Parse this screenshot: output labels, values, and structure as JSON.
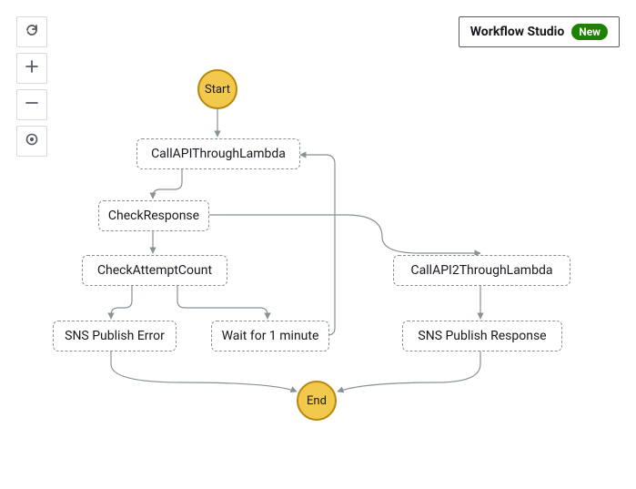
{
  "toolbar": {
    "refresh": "Refresh",
    "zoom_in": "Zoom in",
    "zoom_out": "Zoom out",
    "center": "Center"
  },
  "header": {
    "workflow_studio_label": "Workflow Studio",
    "new_badge": "New"
  },
  "diagram": {
    "start": "Start",
    "end": "End",
    "nodes": {
      "callAPI": "CallAPIThroughLambda",
      "checkResponse": "CheckResponse",
      "checkAttempt": "CheckAttemptCount",
      "snsError": "SNS Publish Error",
      "wait": "Wait for 1 minute",
      "callAPI2": "CallAPI2ThroughLambda",
      "snsResponse": "SNS Publish Response"
    }
  }
}
